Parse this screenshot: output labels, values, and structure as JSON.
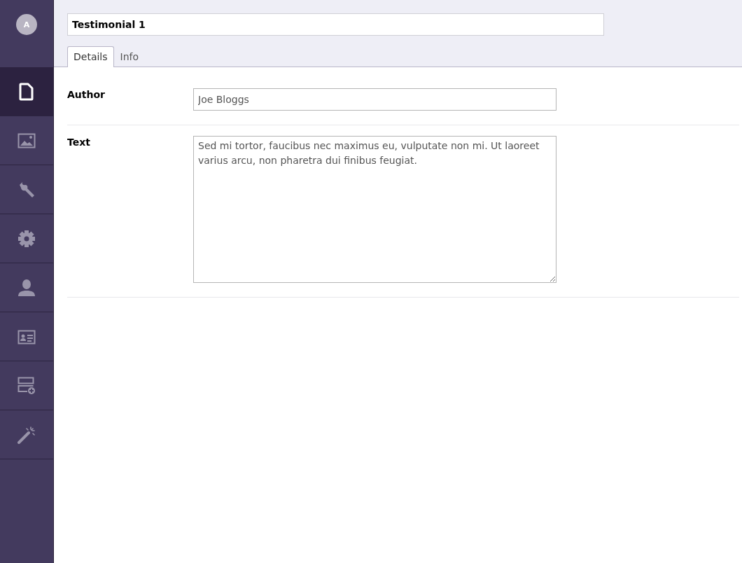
{
  "avatar": {
    "initial": "A"
  },
  "sidebar": {
    "items": [
      {
        "kind": "document",
        "selected": true
      },
      {
        "kind": "image",
        "selected": false
      },
      {
        "kind": "wrench",
        "selected": false
      },
      {
        "kind": "gear",
        "selected": false
      },
      {
        "kind": "person",
        "selected": false
      },
      {
        "kind": "idcard",
        "selected": false
      },
      {
        "kind": "stack",
        "selected": false
      },
      {
        "kind": "wand",
        "selected": false
      }
    ]
  },
  "title": {
    "value": "Testimonial 1"
  },
  "tabs": [
    {
      "label": "Details",
      "selected": true
    },
    {
      "label": "Info",
      "selected": false
    }
  ],
  "fields": [
    {
      "kind": "input",
      "label": "Author",
      "value": "Joe Bloggs"
    },
    {
      "kind": "textarea",
      "label": "Text",
      "value": "Sed mi tortor, faucibus nec maximus eu, vulputate non mi. Ut laoreet varius arcu, non pharetra dui finibus feugiat."
    }
  ]
}
